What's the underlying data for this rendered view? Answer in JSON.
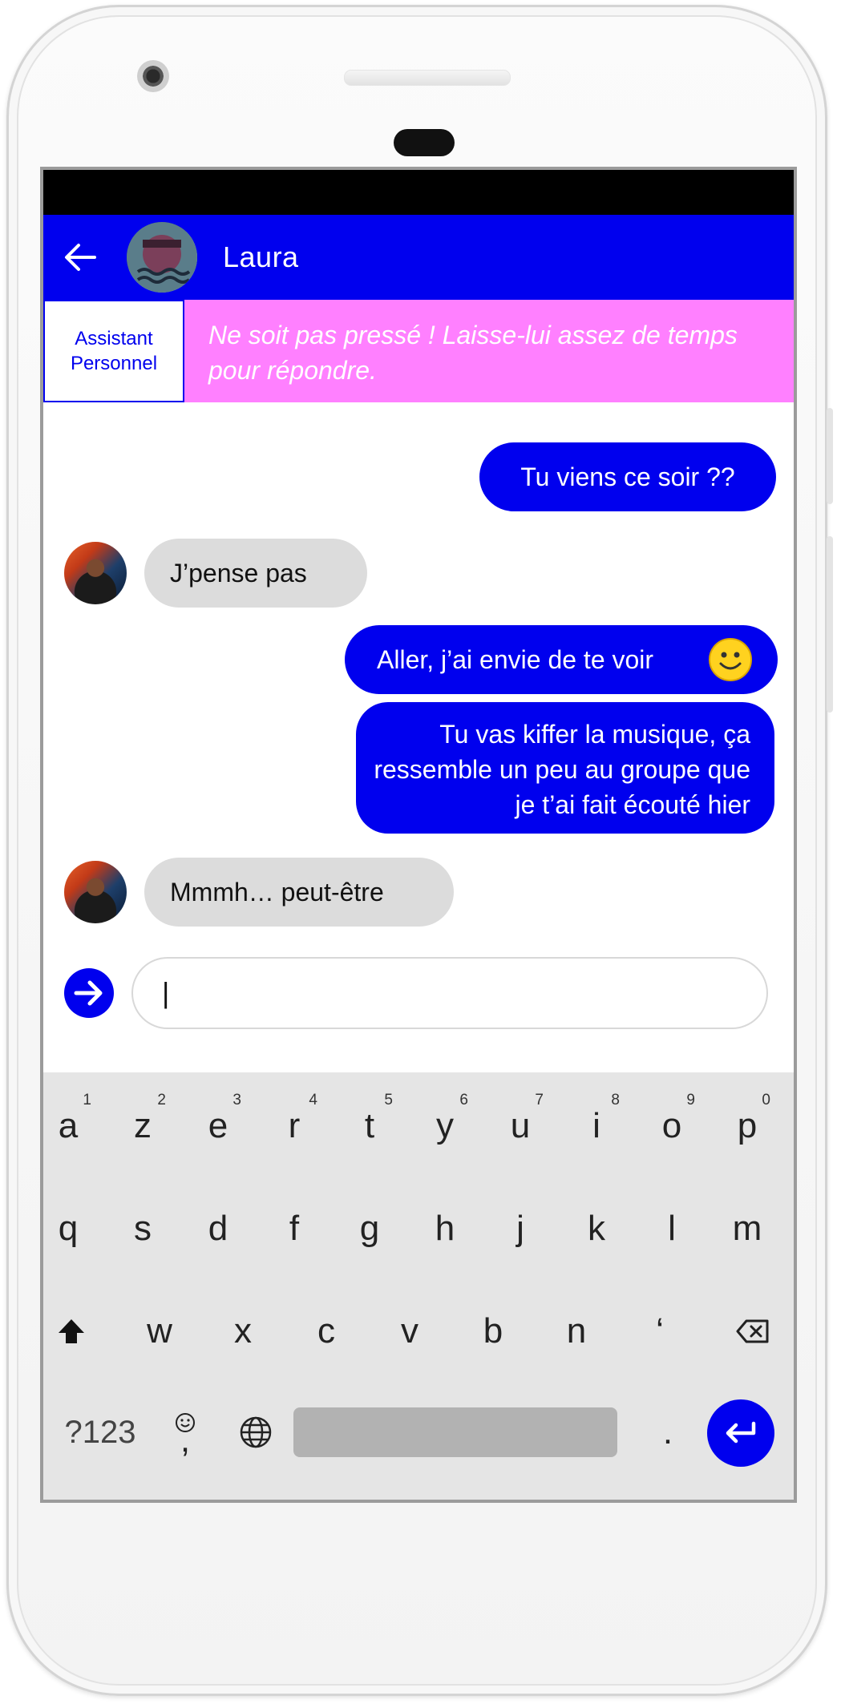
{
  "header": {
    "contact_name": "Laura",
    "back_icon": "arrow-left-icon",
    "accent": "#0000ee"
  },
  "assistant": {
    "label": "Assistant\nPersonnel",
    "tip": "Ne soit pas pressé ! Laisse-lui assez de temps pour répondre.",
    "tip_bg": "#ff80ff"
  },
  "messages": [
    {
      "side": "sent",
      "text": "Tu viens ce soir ??"
    },
    {
      "side": "received",
      "text": "J’pense pas"
    },
    {
      "side": "sent",
      "text": "Aller, j’ai envie de te voir",
      "icon": "smiley-icon"
    },
    {
      "side": "sent",
      "text": "Tu vas kiffer la musique, ça ressemble un peu au groupe que je t’ai fait écouté hier"
    },
    {
      "side": "received",
      "text": "Mmmh… peut-être"
    }
  ],
  "composer": {
    "value": "|",
    "send_icon": "arrow-right-circle-icon"
  },
  "keyboard": {
    "row1": [
      "a",
      "z",
      "e",
      "r",
      "t",
      "y",
      "u",
      "i",
      "o",
      "p"
    ],
    "row1_hints": [
      "1",
      "2",
      "3",
      "4",
      "5",
      "6",
      "7",
      "8",
      "9",
      "0"
    ],
    "row2": [
      "q",
      "s",
      "d",
      "f",
      "g",
      "h",
      "j",
      "k",
      "l",
      "m"
    ],
    "row3": [
      "w",
      "x",
      "c",
      "v",
      "b",
      "n",
      "‘"
    ],
    "symbols_label": "?123",
    "comma_label": ",",
    "period_label": ".",
    "icons": [
      "shift-icon",
      "backspace-icon",
      "emoji-icon",
      "globe-icon",
      "enter-icon"
    ]
  }
}
